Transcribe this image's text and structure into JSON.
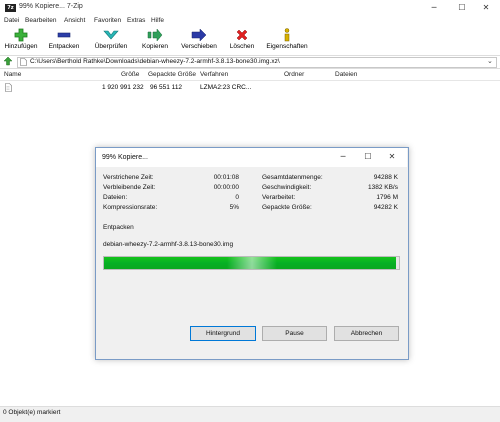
{
  "window": {
    "title": "99% Kopiere... 7-Zip",
    "app_icon_text": "7z",
    "minimize": "─",
    "maximize": "☐",
    "close": "✕"
  },
  "menu": [
    "Datei",
    "Bearbeiten",
    "Ansicht",
    "Favoriten",
    "Extras",
    "Hilfe"
  ],
  "toolbar": {
    "add": "Hinzufügen",
    "extract": "Entpacken",
    "test": "Überprüfen",
    "copy": "Kopieren",
    "move": "Verschieben",
    "delete": "Löschen",
    "properties": "Eigenschaften"
  },
  "address": {
    "path": "C:\\Users\\Berthold Rathke\\Downloads\\debian-wheezy-7.2-armhf-3.8.13-bone30.img.xz\\"
  },
  "columns": [
    "Name",
    "Größe",
    "Gepackte Größe",
    "Verfahren",
    "Ordner",
    "Dateien"
  ],
  "rows": [
    {
      "name": "",
      "size": "1 920 991 232",
      "packed": "96 551 112",
      "method": "LZMA2:23 CRC..."
    }
  ],
  "status": "0 Objekt(e) markiert",
  "dialog": {
    "title": "99% Kopiere...",
    "minimize": "─",
    "maximize": "☐",
    "close": "✕",
    "left": [
      {
        "label": "Verstrichene Zeit:",
        "value": "00:01:08"
      },
      {
        "label": "Verbleibende Zeit:",
        "value": "00:00:00"
      },
      {
        "label": "Dateien:",
        "value": "0"
      },
      {
        "label": "Kompressionsrate:",
        "value": "5%"
      }
    ],
    "right": [
      {
        "label": "Gesamtdatenmenge:",
        "value": "94288 K"
      },
      {
        "label": "Geschwindigkeit:",
        "value": "1382 KB/s"
      },
      {
        "label": "Verarbeitet:",
        "value": "1796 M"
      },
      {
        "label": "Gepackte Größe:",
        "value": "94282 K"
      }
    ],
    "operation": "Entpacken",
    "file": "debian-wheezy-7.2-armhf-3.8.13-bone30.img",
    "progress": 0.99,
    "buttons": {
      "background": "Hintergrund",
      "pause": "Pause",
      "cancel": "Abbrechen"
    }
  },
  "colors": {
    "progress": "#06b025",
    "accent": "#0078d7"
  }
}
